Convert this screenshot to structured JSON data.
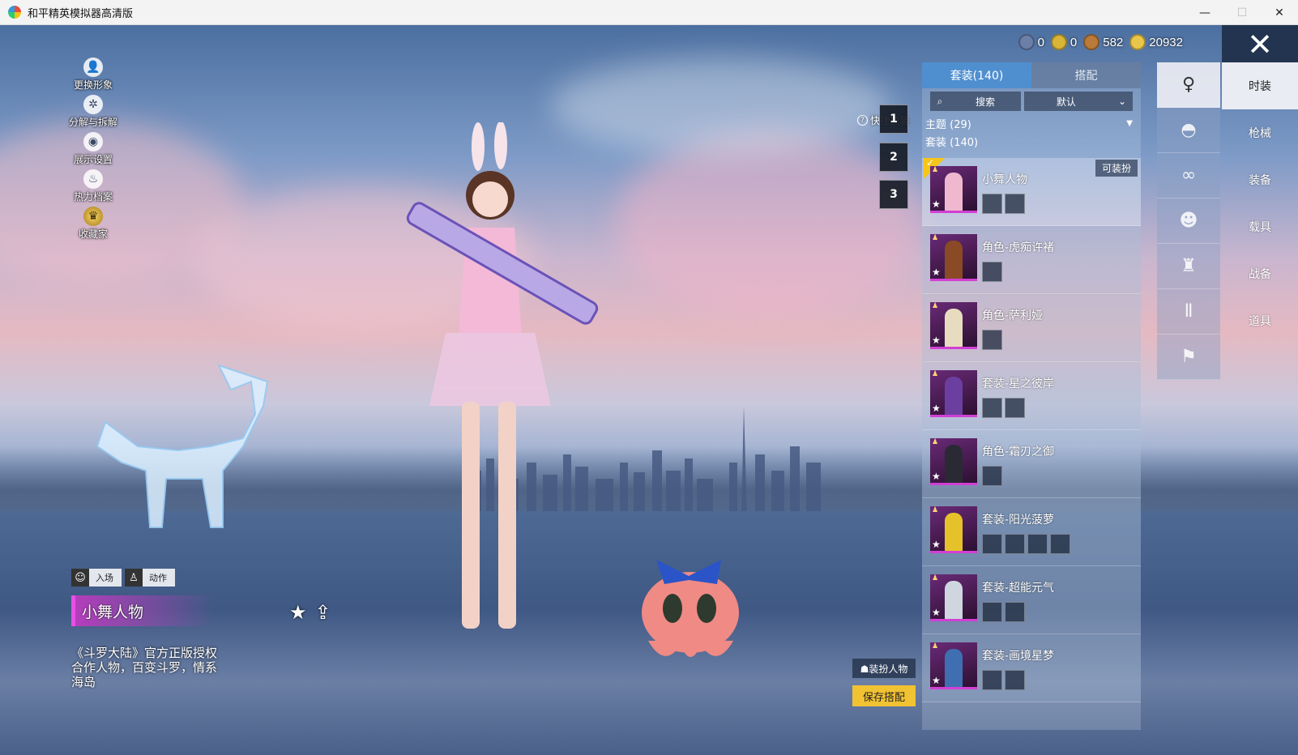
{
  "window": {
    "title": "和平精英模拟器高清版",
    "minimize": "—",
    "maximize": "☐",
    "close": "✕"
  },
  "left_menu": [
    {
      "label": "更换形象",
      "icon": "👤"
    },
    {
      "label": "分解与拆解",
      "icon": "✲"
    },
    {
      "label": "展示设置",
      "icon": "◉"
    },
    {
      "label": "热力档案",
      "icon": "♨"
    },
    {
      "label": "收藏家",
      "icon": "♛"
    }
  ],
  "currencies": [
    {
      "value": "0",
      "color": "#6b7fa8"
    },
    {
      "value": "0",
      "color": "#d8b437"
    },
    {
      "value": "582",
      "color": "#b97a3a"
    },
    {
      "value": "20932",
      "color": "#e8c64a"
    }
  ],
  "close_game": "✕",
  "character_info": {
    "actions": [
      {
        "label": "入场",
        "icon": "☺"
      },
      {
        "label": "动作",
        "icon": "♙"
      }
    ],
    "name": "小舞人物",
    "favorite_icon": "★",
    "share_icon": "⇪",
    "description": "《斗罗大陆》官方正版授权合作人物，百变斗罗，情系海岛"
  },
  "quick_change": {
    "title": "快捷换装",
    "help": "?",
    "slots": [
      "1",
      "2",
      "3"
    ]
  },
  "buttons": {
    "dress": "☗装扮人物",
    "save": "保存搭配"
  },
  "panel": {
    "tabs": [
      {
        "label": "套装(140)",
        "active": true
      },
      {
        "label": "搭配",
        "active": false
      }
    ],
    "search_placeholder": "搜索",
    "search_icon": "⌕",
    "sort_label": "默认",
    "sort_arrow": "⌄",
    "theme_filter": "主题 (29)",
    "filter_arrow": "▼",
    "suit_count": "套装 (140)",
    "equippable_badge": "可装扮",
    "suits": [
      {
        "name": "小舞人物",
        "parts": 2,
        "selected": true,
        "fig": "#f0b8cf",
        "badge": true
      },
      {
        "name": "角色-虎痴许褚",
        "parts": 1,
        "selected": false,
        "fig": "#8a4a26",
        "badge": false
      },
      {
        "name": "角色-萨利娅",
        "parts": 1,
        "selected": false,
        "fig": "#e8dcc0",
        "badge": false
      },
      {
        "name": "套装-星之彼岸",
        "parts": 2,
        "selected": false,
        "fig": "#6a3fa0",
        "badge": false
      },
      {
        "name": "角色-霜刃之御",
        "parts": 1,
        "selected": false,
        "fig": "#2a2a35",
        "badge": false
      },
      {
        "name": "套装-阳光菠萝",
        "parts": 4,
        "selected": false,
        "fig": "#e6c22a",
        "badge": false
      },
      {
        "name": "套装-超能元气",
        "parts": 2,
        "selected": false,
        "fig": "#cfd6e0",
        "badge": false
      },
      {
        "name": "套装-画境星梦",
        "parts": 2,
        "selected": false,
        "fig": "#3f6fb0",
        "badge": false
      }
    ]
  },
  "categories": [
    {
      "name": "character",
      "icon": "♀"
    },
    {
      "name": "hat",
      "icon": "◓"
    },
    {
      "name": "glasses",
      "icon": "∞"
    },
    {
      "name": "mask",
      "icon": "☻"
    },
    {
      "name": "top",
      "icon": "♜"
    },
    {
      "name": "pants",
      "icon": "Ⅱ"
    },
    {
      "name": "shoes",
      "icon": "⚑"
    }
  ],
  "right_nav": [
    {
      "label": "时装",
      "active": true
    },
    {
      "label": "枪械",
      "active": false
    },
    {
      "label": "装备",
      "active": false
    },
    {
      "label": "载具",
      "active": false
    },
    {
      "label": "战备",
      "active": false
    },
    {
      "label": "道具",
      "active": false
    }
  ]
}
